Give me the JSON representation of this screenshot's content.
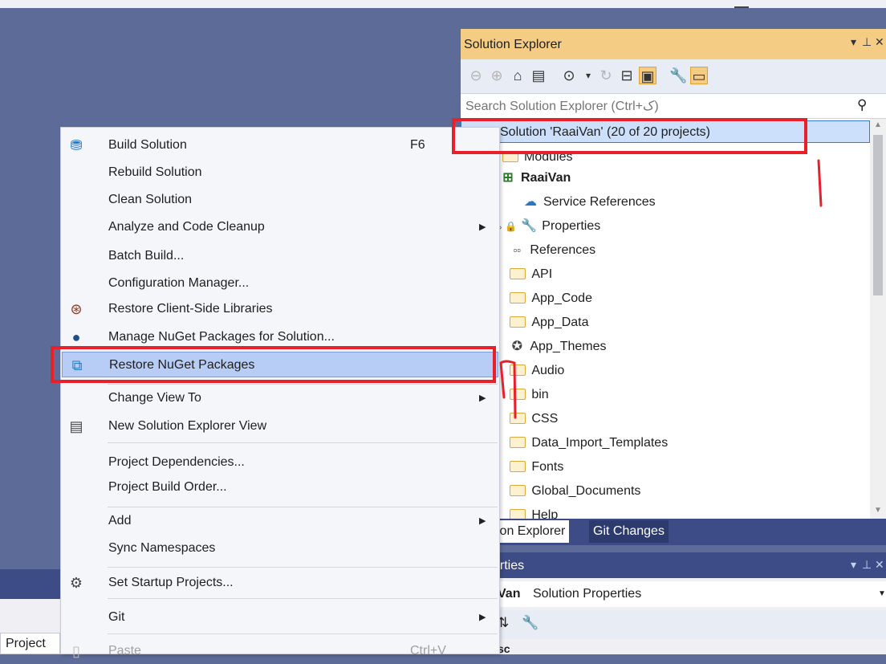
{
  "colors": {
    "accent_yellow": "#f5cc84",
    "nav_blue": "#3d4c86",
    "annotation_red": "#e8202a",
    "menu_highlight": "#b8cdf5"
  },
  "solution_explorer": {
    "title": "Solution Explorer",
    "title_controls": [
      "▾",
      "⊥",
      "✕"
    ],
    "search_placeholder": "Search Solution Explorer (Ctrl+ک)",
    "tree": [
      {
        "label": "Solution 'RaaiVan' (20 of 20 projects)",
        "selected": true,
        "bold": false,
        "icon": "solution-icon"
      },
      {
        "label": "Modules",
        "icon": "folder-icon"
      },
      {
        "label": "RaaiVan",
        "bold": true,
        "icon": "web-project-icon"
      },
      {
        "label": "Service References",
        "icon": "cloud-icon"
      },
      {
        "label": "Properties",
        "icon": "wrench-icon"
      },
      {
        "label": "References",
        "icon": "references-icon"
      },
      {
        "label": "API",
        "icon": "folder-icon"
      },
      {
        "label": "App_Code",
        "icon": "folder-icon"
      },
      {
        "label": "App_Data",
        "icon": "folder-icon"
      },
      {
        "label": "App_Themes",
        "icon": "themes-icon"
      },
      {
        "label": "Audio",
        "icon": "folder-icon"
      },
      {
        "label": "bin",
        "icon": "folder-icon"
      },
      {
        "label": "CSS",
        "icon": "folder-icon"
      },
      {
        "label": "Data_Import_Templates",
        "icon": "folder-icon"
      },
      {
        "label": "Fonts",
        "icon": "folder-icon"
      },
      {
        "label": "Global_Documents",
        "icon": "folder-icon"
      },
      {
        "label": "Help",
        "icon": "folder-icon"
      }
    ],
    "tabs": [
      {
        "label": "ion Explorer",
        "active": true
      },
      {
        "label": "Git Changes",
        "active": false
      }
    ]
  },
  "properties": {
    "title": "erties",
    "object_name": "Van",
    "object_desc": "Solution Properties",
    "more_label": "sc"
  },
  "context_menu": {
    "items": [
      {
        "label": "Build Solution",
        "shortcut": "F6",
        "icon": "build-icon"
      },
      {
        "label": "Rebuild Solution"
      },
      {
        "label": "Clean Solution"
      },
      {
        "label": "Analyze and Code Cleanup",
        "submenu": true
      },
      {
        "label": "Batch Build..."
      },
      {
        "label": "Configuration Manager..."
      },
      {
        "label": "Restore Client-Side Libraries",
        "icon": "client-libraries-icon"
      },
      {
        "label": "Manage NuGet Packages for Solution...",
        "icon": "nuget-icon"
      },
      {
        "label": "Restore NuGet Packages",
        "icon": "restore-nuget-icon",
        "highlighted": true
      },
      {
        "label": "Change View To",
        "submenu": true
      },
      {
        "label": "New Solution Explorer View",
        "icon": "new-view-icon"
      },
      {
        "label": "Project Dependencies..."
      },
      {
        "label": "Project Build Order..."
      },
      {
        "label": "Add",
        "submenu": true
      },
      {
        "label": "Sync Namespaces"
      },
      {
        "label": "Set Startup Projects...",
        "icon": "settings-icon"
      },
      {
        "label": "Git",
        "submenu": true
      },
      {
        "label": "Paste",
        "shortcut": "Ctrl+V",
        "icon": "paste-icon",
        "disabled": true
      }
    ]
  },
  "left_bottom": {
    "project_tab": "Project"
  }
}
